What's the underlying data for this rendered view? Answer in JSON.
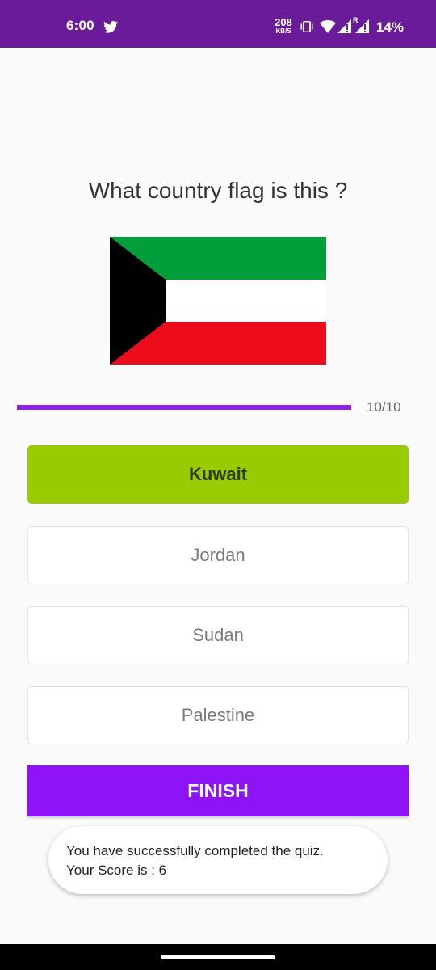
{
  "status_bar": {
    "time": "6:00",
    "net_speed_value": "208",
    "net_speed_unit": "KB/S",
    "roaming": "R",
    "battery": "14%",
    "icons": [
      "twitter-icon",
      "vibrate-icon",
      "wifi-icon",
      "signal-icon",
      "signal-icon"
    ],
    "background": "#6a1b9a"
  },
  "quiz": {
    "question": "What country flag is this ?",
    "flag": {
      "country": "Kuwait",
      "colors": {
        "green": "#009e3b",
        "white": "#ffffff",
        "red": "#ed0c1c",
        "black": "#000000"
      }
    },
    "progress": {
      "text": "10/10",
      "current": 10,
      "total": 10,
      "fill_color": "#8e1ef0"
    },
    "options": [
      {
        "label": "Kuwait",
        "state": "correct"
      },
      {
        "label": "Jordan",
        "state": "default"
      },
      {
        "label": "Sudan",
        "state": "default"
      },
      {
        "label": "Palestine",
        "state": "default"
      }
    ],
    "correct_color": "#99cc00",
    "finish_label": "FINISH",
    "finish_color": "#8e13f7"
  },
  "toast": {
    "line1": "You have successfully completed the quiz.",
    "line2": "Your Score is : 6"
  }
}
